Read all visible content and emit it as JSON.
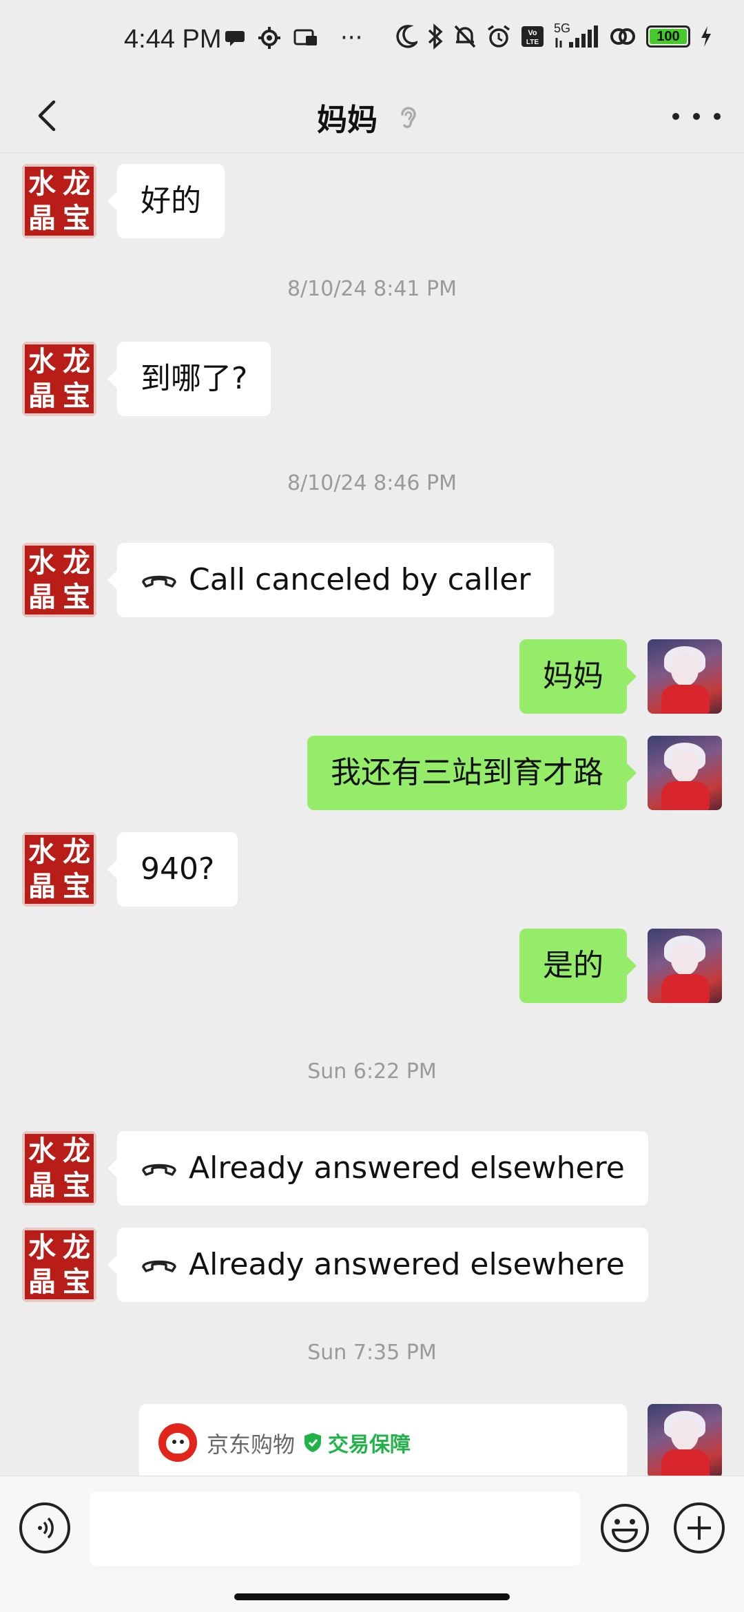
{
  "status_bar": {
    "time": "4:44 PM",
    "network": "5G",
    "battery_percent": "100",
    "icons_left": [
      "chat-bubble-icon",
      "gear-icon",
      "card-icon",
      "ellipsis-icon"
    ],
    "icons_right": [
      "moon-icon",
      "bluetooth-icon",
      "bell-off-icon",
      "alarm-icon",
      "volte-icon",
      "signal-icon",
      "link-icon",
      "battery-icon",
      "charging-icon"
    ]
  },
  "nav": {
    "title": "妈妈",
    "back_icon": "chevron-left-icon",
    "earpiece_icon": "ear-icon",
    "more_icon": "more-icon"
  },
  "contact_avatar": {
    "chars": [
      "水",
      "龙",
      "晶",
      "宝"
    ],
    "color": "#b81d17"
  },
  "colors": {
    "background": "#ededed",
    "outgoing_bubble": "#95ec69",
    "incoming_bubble": "#ffffff",
    "timestamp": "#9a9a9a",
    "guarantee": "#21b34a"
  },
  "messages": [
    {
      "side": "left",
      "text": "好的"
    },
    {
      "type": "timestamp",
      "text": "8/10/24 8:41 PM"
    },
    {
      "side": "left",
      "text": "到哪了?"
    },
    {
      "type": "timestamp",
      "text": "8/10/24 8:46 PM"
    },
    {
      "side": "left",
      "type": "call",
      "text": "Call canceled by caller"
    },
    {
      "side": "right",
      "text": "妈妈"
    },
    {
      "side": "right",
      "text": "我还有三站到育才路"
    },
    {
      "side": "left",
      "text": "940?"
    },
    {
      "side": "right",
      "text": "是的"
    },
    {
      "type": "timestamp",
      "text": "Sun 6:22 PM"
    },
    {
      "side": "left",
      "type": "call",
      "text": "Already answered elsewhere"
    },
    {
      "side": "left",
      "type": "call",
      "text": "Already answered elsewhere"
    },
    {
      "type": "timestamp",
      "text": "Sun 7:35 PM"
    }
  ],
  "card": {
    "brand": "京东购物",
    "badge": "交易保障"
  },
  "input_bar": {
    "placeholder": "",
    "voice_icon": "voice-icon",
    "emoji_icon": "emoji-icon",
    "plus_icon": "plus-icon"
  }
}
